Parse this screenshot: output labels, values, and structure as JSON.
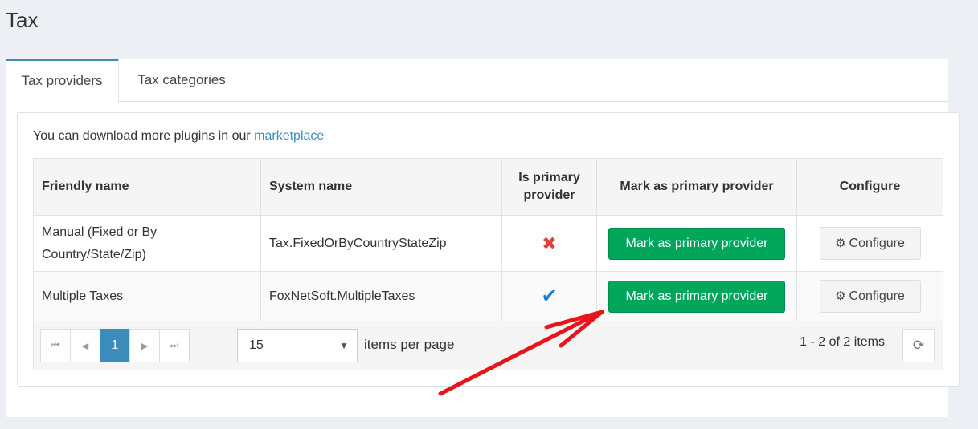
{
  "page": {
    "title": "Tax"
  },
  "tabs": [
    {
      "label": "Tax providers",
      "active": true
    },
    {
      "label": "Tax categories",
      "active": false
    }
  ],
  "info": {
    "text": "You can download more plugins in our ",
    "link": "marketplace"
  },
  "table": {
    "headers": {
      "friendly_name": "Friendly name",
      "system_name": "System name",
      "is_primary": "Is primary provider",
      "mark_primary": "Mark as primary provider",
      "configure": "Configure"
    },
    "rows": [
      {
        "friendly_name": "Manual (Fixed or By Country/State/Zip)",
        "system_name": "Tax.FixedOrByCountryStateZip",
        "is_primary": false,
        "mark_label": "Mark as primary provider",
        "configure_label": "Configure"
      },
      {
        "friendly_name": "Multiple Taxes",
        "system_name": "FoxNetSoft.MultipleTaxes",
        "is_primary": true,
        "mark_label": "Mark as primary provider",
        "configure_label": "Configure"
      }
    ]
  },
  "pager": {
    "current_page": "1",
    "page_size": "15",
    "items_per_page_label": "items per page",
    "items_info": "1 - 2 of 2 items"
  },
  "icons": {
    "first": "first-page-icon",
    "prev": "prev-page-icon",
    "next": "next-page-icon",
    "last": "last-page-icon",
    "refresh": "refresh-icon",
    "gear": "gear-icon",
    "cross": "cross-icon",
    "check": "check-icon"
  },
  "colors": {
    "accent": "#3c8dbc",
    "success": "#00a65a",
    "danger": "#d9443a",
    "check": "#1b7ccf",
    "annotation": "#e8141a"
  }
}
